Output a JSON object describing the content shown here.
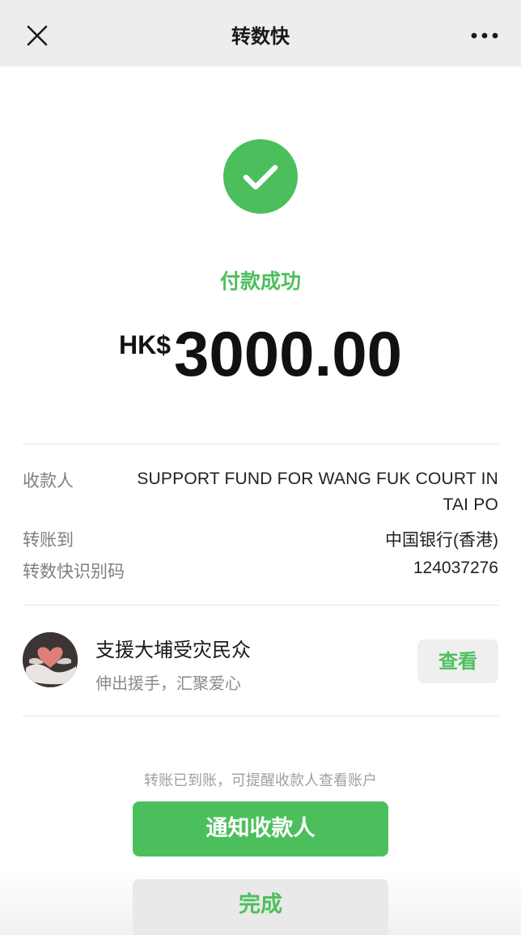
{
  "nav": {
    "title": "转数快",
    "close_icon": "close-icon",
    "more_icon": "more-dots-icon"
  },
  "result": {
    "icon": "checkmark-circle-icon",
    "status": "付款成功",
    "currency": "HK$",
    "amount": "3000.00"
  },
  "details": {
    "payee_label": "收款人",
    "payee_value": "SUPPORT FUND FOR WANG FUK COURT IN TAI PO",
    "transfer_to_label": "转账到",
    "transfer_to_value": "中国银行(香港)",
    "fps_id_label": "转数快识别码",
    "fps_id_value": "124037276"
  },
  "campaign": {
    "avatar_icon": "heart-in-hands-icon",
    "title": "支援大埔受灾民众",
    "subtitle": "伸出援手，汇聚爱心",
    "view_label": "查看"
  },
  "footer": {
    "hint": "转账已到账，可提醒收款人查看账户",
    "notify_label": "通知收款人",
    "done_label": "完成"
  },
  "colors": {
    "accent_green": "#4cbf5d",
    "nav_background": "#ededed",
    "amount_text": "#111111",
    "secondary_text": "#7f7f7f"
  }
}
